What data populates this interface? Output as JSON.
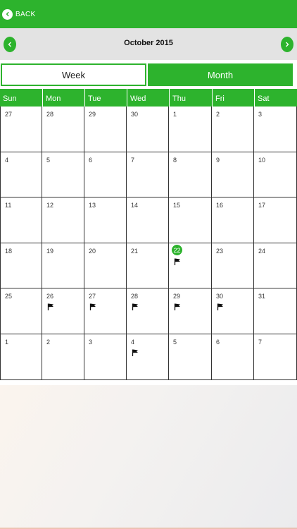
{
  "header": {
    "back_label": "BACK"
  },
  "month_bar": {
    "title": "October 2015"
  },
  "view_toggle": {
    "week_label": "Week",
    "month_label": "Month",
    "selected": "Month"
  },
  "weekdays": [
    "Sun",
    "Mon",
    "Tue",
    "Wed",
    "Thu",
    "Fri",
    "Sat"
  ],
  "weeks": [
    [
      {
        "day": "27"
      },
      {
        "day": "28"
      },
      {
        "day": "29"
      },
      {
        "day": "30"
      },
      {
        "day": "1"
      },
      {
        "day": "2"
      },
      {
        "day": "3"
      }
    ],
    [
      {
        "day": "4"
      },
      {
        "day": "5"
      },
      {
        "day": "6"
      },
      {
        "day": "7"
      },
      {
        "day": "8"
      },
      {
        "day": "9"
      },
      {
        "day": "10"
      }
    ],
    [
      {
        "day": "11"
      },
      {
        "day": "12"
      },
      {
        "day": "13"
      },
      {
        "day": "14"
      },
      {
        "day": "15"
      },
      {
        "day": "16"
      },
      {
        "day": "17"
      }
    ],
    [
      {
        "day": "18"
      },
      {
        "day": "19"
      },
      {
        "day": "20"
      },
      {
        "day": "21"
      },
      {
        "day": "22",
        "today": true,
        "flag": true
      },
      {
        "day": "23"
      },
      {
        "day": "24"
      }
    ],
    [
      {
        "day": "25"
      },
      {
        "day": "26",
        "flag": true
      },
      {
        "day": "27",
        "flag": true
      },
      {
        "day": "28",
        "flag": true
      },
      {
        "day": "29",
        "flag": true
      },
      {
        "day": "30",
        "flag": true
      },
      {
        "day": "31"
      }
    ],
    [
      {
        "day": "1"
      },
      {
        "day": "2"
      },
      {
        "day": "3"
      },
      {
        "day": "4",
        "flag": true
      },
      {
        "day": "5"
      },
      {
        "day": "6"
      },
      {
        "day": "7"
      }
    ]
  ],
  "colors": {
    "accent": "#2db32d",
    "month_bar_bg": "#e3e3e3",
    "grid_line": "#333333"
  },
  "icons": {
    "back": "chevron-left-icon",
    "prev": "chevron-left-icon",
    "next": "chevron-right-icon",
    "event": "flag-icon"
  }
}
